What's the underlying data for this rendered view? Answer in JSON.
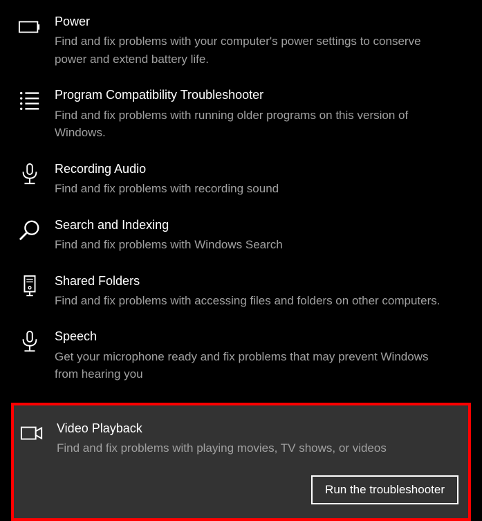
{
  "troubleshooters": [
    {
      "id": "power",
      "title": "Power",
      "description": "Find and fix problems with your computer's power settings to conserve power and extend battery life.",
      "icon": "battery-icon",
      "selected": false
    },
    {
      "id": "program-compatibility",
      "title": "Program Compatibility Troubleshooter",
      "description": "Find and fix problems with running older programs on this version of Windows.",
      "icon": "list-icon",
      "selected": false
    },
    {
      "id": "recording-audio",
      "title": "Recording Audio",
      "description": "Find and fix problems with recording sound",
      "icon": "microphone-icon",
      "selected": false
    },
    {
      "id": "search-indexing",
      "title": "Search and Indexing",
      "description": "Find and fix problems with Windows Search",
      "icon": "search-icon",
      "selected": false
    },
    {
      "id": "shared-folders",
      "title": "Shared Folders",
      "description": "Find and fix problems with accessing files and folders on other computers.",
      "icon": "server-icon",
      "selected": false
    },
    {
      "id": "speech",
      "title": "Speech",
      "description": "Get your microphone ready and fix problems that may prevent Windows from hearing you",
      "icon": "microphone-icon",
      "selected": false
    },
    {
      "id": "video-playback",
      "title": "Video Playback",
      "description": "Find and fix problems with playing movies, TV shows, or videos",
      "icon": "video-icon",
      "selected": true
    }
  ],
  "run_button_label": "Run the troubleshooter",
  "colors": {
    "background": "#000000",
    "text_primary": "#ffffff",
    "text_secondary": "#a0a0a0",
    "selected_bg": "#333333",
    "selected_border": "#ff0000"
  }
}
